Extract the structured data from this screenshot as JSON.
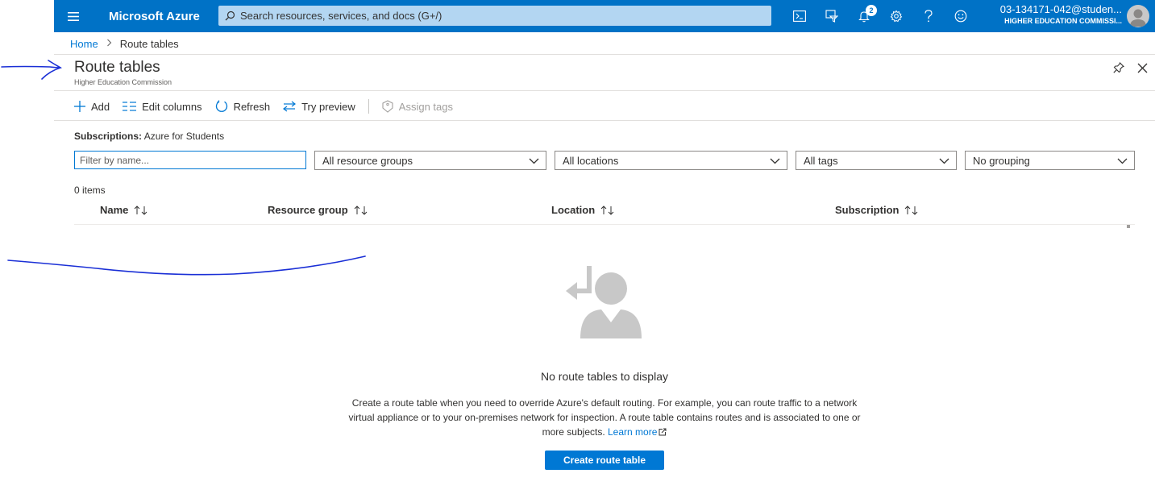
{
  "topbar": {
    "brand": "Microsoft Azure",
    "search_placeholder": "Search resources, services, and docs (G+/)",
    "notification_count": "2",
    "icons": [
      "cloud-shell-icon",
      "directory-filter-icon",
      "notifications-icon",
      "settings-icon",
      "help-icon",
      "feedback-icon"
    ],
    "account_email": "03-134171-042@studen...",
    "account_tenant": "HIGHER EDUCATION COMMISSI..."
  },
  "breadcrumb": {
    "home": "Home",
    "current": "Route tables"
  },
  "blade": {
    "title": "Route tables",
    "subtitle": "Higher Education Commission"
  },
  "commands": {
    "add": "Add",
    "edit_columns": "Edit columns",
    "refresh": "Refresh",
    "try_preview": "Try preview",
    "assign_tags": "Assign tags"
  },
  "filters": {
    "subscriptions_label": "Subscriptions:",
    "subscriptions_value": "Azure for Students",
    "name_placeholder": "Filter by name...",
    "resource_groups": "All resource groups",
    "locations": "All locations",
    "tags": "All tags",
    "grouping": "No grouping"
  },
  "table": {
    "items_count": "0 items",
    "columns": [
      "Name",
      "Resource group",
      "Location",
      "Subscription"
    ]
  },
  "empty_state": {
    "title": "No route tables to display",
    "description": "Create a route table when you need to override Azure's default routing. For example, you can route traffic to a network virtual appliance or to your on-premises network for inspection. A route table contains routes and is associated to one or more subjects.",
    "learn_more": "Learn more",
    "create_button": "Create route table"
  },
  "colors": {
    "topbar": "#0072c6",
    "accent": "#0078d4",
    "annotation_ink": "#1a2fd6"
  }
}
